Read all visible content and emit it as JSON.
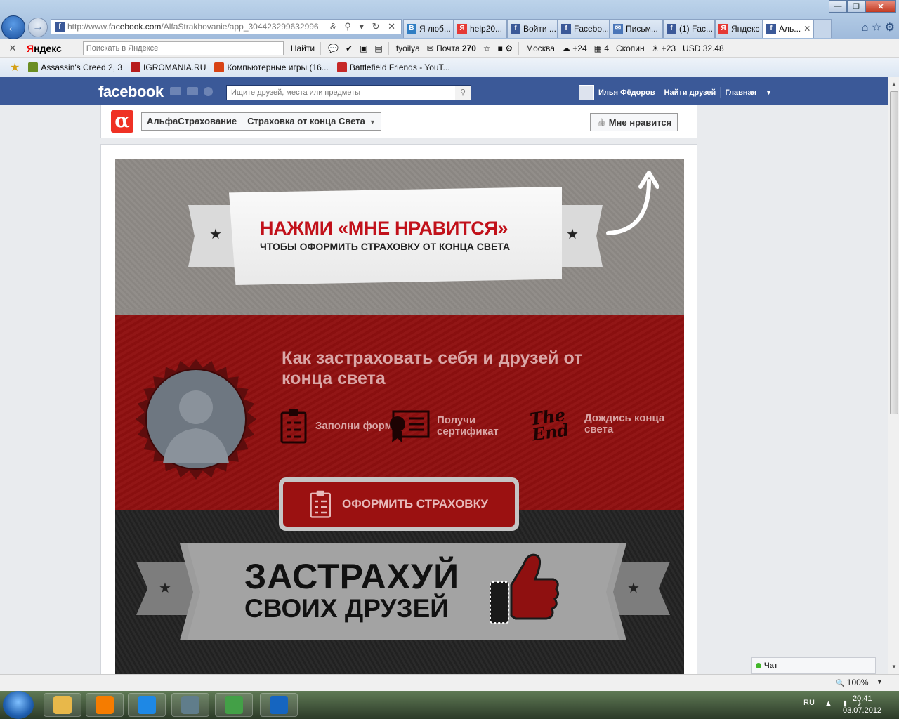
{
  "browser": {
    "url_prefix": "http://www.",
    "url_domain": "facebook.com",
    "url_path": "/AlfaStrakhovanie/app_304423299632996",
    "url_tools": "& ⚲ ▾ ↻ ✕",
    "tabs": [
      {
        "icon_color": "#2f7ec3",
        "glyph": "В",
        "label": "Я люб..."
      },
      {
        "icon_color": "#e53935",
        "glyph": "Я",
        "label": "help20..."
      },
      {
        "icon_color": "#3b5998",
        "glyph": "f",
        "label": "Войти ..."
      },
      {
        "icon_color": "#3b5998",
        "glyph": "f",
        "label": "Facebo..."
      },
      {
        "icon_color": "#4a76b8",
        "glyph": "✉",
        "label": "Письм..."
      },
      {
        "icon_color": "#3b5998",
        "glyph": "f",
        "label": "(1) Fac..."
      },
      {
        "icon_color": "#e53935",
        "glyph": "Я",
        "label": "Яндекс"
      },
      {
        "icon_color": "#3b5998",
        "glyph": "f",
        "label": "Аль...",
        "active": true
      }
    ],
    "window_controls": {
      "minimize": "—",
      "maximize": "❐",
      "close": "✕"
    },
    "right_icons": "⌂ ☆ ⚙"
  },
  "yandex_bar": {
    "close": "✕",
    "logo_first": "Я",
    "logo_rest": "ндекс",
    "search_placeholder": "Поискать в Яндексе",
    "find_label": "Найти",
    "user": "fyoilya",
    "mail_label": "Почта",
    "mail_count": "270",
    "city1": "Москва",
    "temp1": "+24",
    "count2": "4",
    "city2": "Скопин",
    "temp2": "+23",
    "usd": "USD 32.48"
  },
  "favorites": [
    {
      "label": "Assassin's Creed 2, 3",
      "color": "#6b8e23"
    },
    {
      "label": "IGROMANIA.RU",
      "color": "#b71c1c"
    },
    {
      "label": "Компьютерные игры (16...",
      "color": "#d84315"
    },
    {
      "label": "Battlefield Friends - YouT...",
      "color": "#c62828"
    }
  ],
  "facebook": {
    "logo": "facebook",
    "search_placeholder": "Ищите друзей, места или предметы",
    "search_icon": "⚲",
    "user_name": "Илья Фёдоров",
    "find_friends": "Найти друзей",
    "home": "Главная",
    "caret": "▼"
  },
  "app_header": {
    "logo_glyph": "α",
    "page_name": "АльфаСтрахование",
    "app_name": "Страховка от конца Света",
    "caret": "▼",
    "like_icon": "👍",
    "like_label": "Мне нравится"
  },
  "app": {
    "cta_title": "НАЖМИ «МНЕ НРАВИТСЯ»",
    "cta_subtitle": "ЧТОБЫ ОФОРМИТЬ СТРАХОВКУ ОТ КОНЦА СВЕТА",
    "star": "★",
    "red_heading": "Как застраховать себя и друзей от конца света",
    "steps": [
      {
        "label": "Заполни форму"
      },
      {
        "label": "Получи сертификат"
      },
      {
        "label": "Дождись конца света"
      }
    ],
    "the_end_logo": "The End",
    "order_button": "ОФОРМИТЬ СТРАХОВКУ",
    "dark_title1": "ЗАСТРАХУЙ",
    "dark_title2": "СВОИХ ДРУЗЕЙ"
  },
  "chat_label": "Чат",
  "status": {
    "zoom": "100%",
    "zoom_icon": "🔍",
    "caret": "▼"
  },
  "taskbar": {
    "lang": "RU",
    "tray": "▲ ▮ ♪",
    "time": "20:41",
    "date": "03.07.2012",
    "apps": [
      {
        "color": "#e8b84a"
      },
      {
        "color": "#f57c00"
      },
      {
        "color": "#1e88e5"
      },
      {
        "color": "#607d8b"
      },
      {
        "color": "#43a047"
      },
      {
        "color": "#1565c0"
      }
    ]
  }
}
